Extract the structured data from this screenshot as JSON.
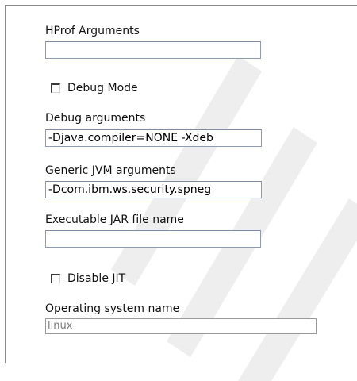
{
  "hprof": {
    "label": "HProf Arguments",
    "value": ""
  },
  "debug_mode": {
    "label": "Debug Mode",
    "checked": false
  },
  "debug_arguments": {
    "label": "Debug arguments",
    "value": "-Djava.compiler=NONE -Xdeb"
  },
  "generic_jvm_arguments": {
    "label": "Generic JVM arguments",
    "value": "-Dcom.ibm.ws.security.spneg"
  },
  "executable_jar": {
    "label": "Executable JAR file name",
    "value": ""
  },
  "disable_jit": {
    "label": "Disable JIT",
    "checked": false
  },
  "os_name": {
    "label": "Operating system name",
    "value": "linux"
  }
}
